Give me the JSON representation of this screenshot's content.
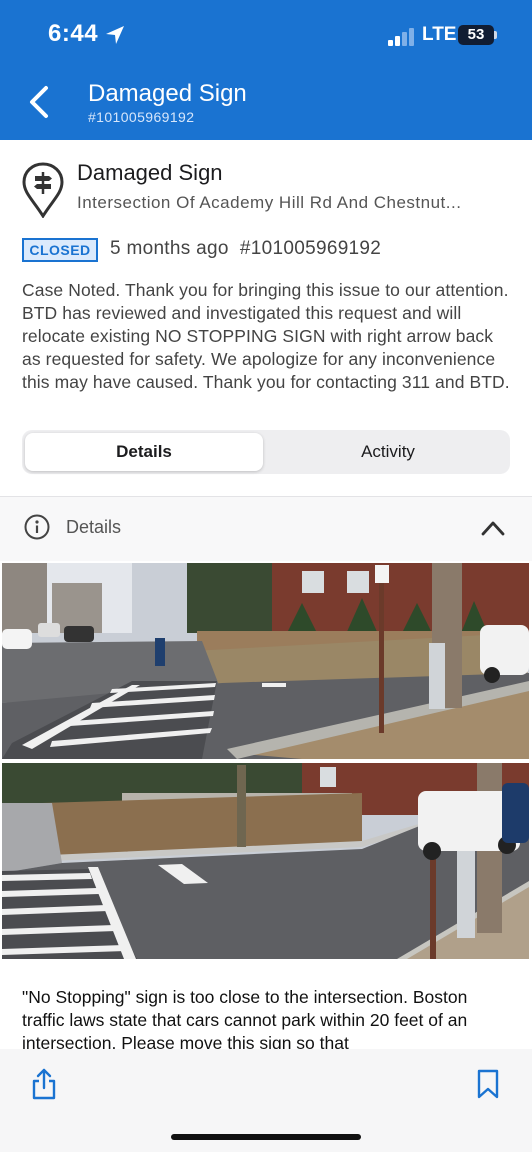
{
  "status_bar": {
    "time": "6:44",
    "network": "LTE",
    "battery": "53"
  },
  "nav": {
    "title": "Damaged Sign",
    "subtitle": "#101005969192"
  },
  "case": {
    "title": "Damaged Sign",
    "address": "Intersection Of Academy Hill Rd And Chestnut...",
    "status_badge": "CLOSED",
    "meta": "5 months ago  #101005969192",
    "description": "Case Noted. Thank you for bringing this issue to our attention. BTD has reviewed and investigated this request and will relocate existing NO STOPPING SIGN with right arrow back as requested for safety. We apologize for any inconvenience this may have caused. Thank you for contacting 311 and BTD."
  },
  "tabs": [
    {
      "label": "Details",
      "selected": true
    },
    {
      "label": "Activity",
      "selected": false
    }
  ],
  "details_section": {
    "label": "Details"
  },
  "report_text": "\"No Stopping\" sign is too close to the intersection. Boston traffic laws state that cars cannot park within 20 feet of an intersection. Please move this sign so that",
  "icons": {
    "location_arrow": "location-arrow-icon",
    "back": "chevron-left-icon",
    "case_type": "signpost-pin-icon",
    "info": "info-circle-icon",
    "collapse": "chevron-up-icon",
    "share": "share-icon",
    "bookmark": "bookmark-icon"
  },
  "colors": {
    "header_blue": "#1a73d1",
    "badge_border": "#1a73d1",
    "badge_bg": "#dbeafc"
  }
}
